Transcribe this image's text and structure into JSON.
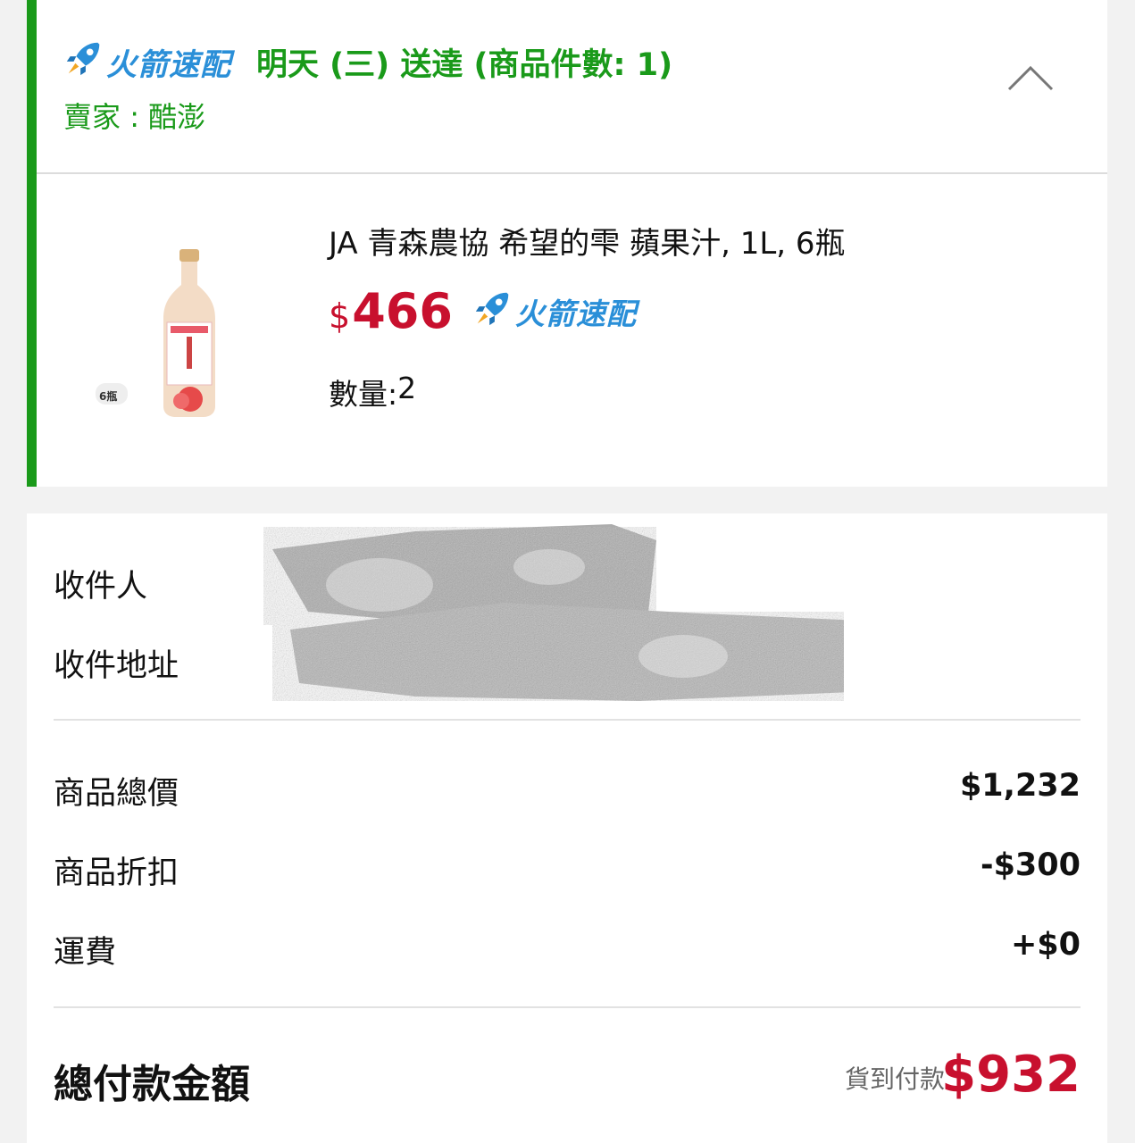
{
  "colors": {
    "accent_green": "#1a9a1a",
    "rocket_blue": "#2a8fd8",
    "price_red": "#c8102e"
  },
  "shipment": {
    "badge_label": "火箭速配",
    "badge_icon": "rocket-icon",
    "delivery_text": "明天 (三) 送達 (商品件數: 1)",
    "seller_label": "賣家",
    "seller_sep": " : ",
    "seller_name": "酷澎",
    "collapse_icon": "chevron-up-icon"
  },
  "product": {
    "name": "JA 青森農協 希望的雫 蘋果汁, 1L, 6瓶",
    "price_currency": "$",
    "price_amount": "466",
    "badge_label": "火箭速配",
    "quantity_label": "數量: ",
    "quantity_value": "2",
    "thumb_badge": "6瓶"
  },
  "recipient": {
    "name_label": "收件人",
    "address_label": "收件地址"
  },
  "summary": {
    "subtotal_label": "商品總價",
    "subtotal_value": "$1,232",
    "discount_label": "商品折扣",
    "discount_value": "-$300",
    "shipping_label": "運費",
    "shipping_value": "+$0",
    "total_label": "總付款金額",
    "payment_method": "貨到付款",
    "total_value": "$932"
  }
}
